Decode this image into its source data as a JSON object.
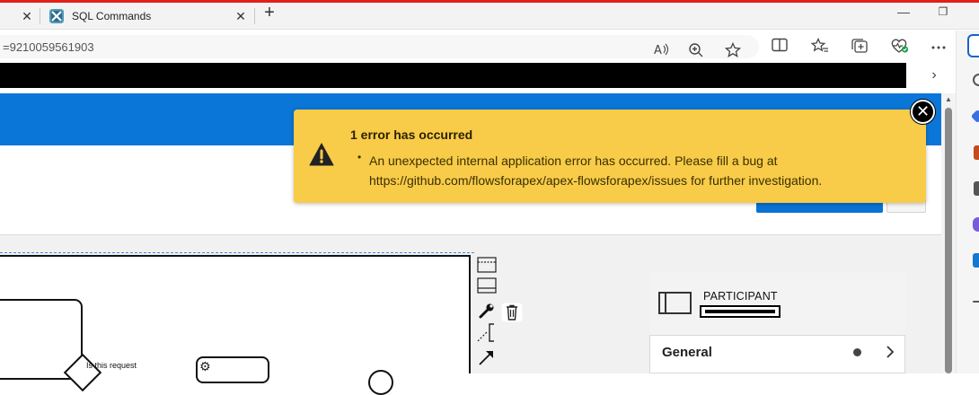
{
  "browser": {
    "tabs": [
      {
        "label": "",
        "close": "✕"
      },
      {
        "label": "SQL Commands",
        "close": "✕"
      }
    ],
    "new_tab": "+",
    "window_controls": {
      "minimize": "—",
      "maximize": "❐"
    },
    "url": "=9210059561903",
    "toolbar_icons": [
      "read-aloud-icon",
      "zoom-icon",
      "favorite-star-icon",
      "split-screen-icon",
      "favorites-icon",
      "collections-icon",
      "browser-essentials-icon",
      "more-icon"
    ],
    "bookmark_chevron": "›"
  },
  "error": {
    "title": "1 error has occurred",
    "bullet": "•",
    "message": "An unexpected internal application error has occurred. Please fill a bug at https://github.com/flowsforapex/apex-flowsforapex/issues for further investigation.",
    "close": "✕",
    "icon": "warning-icon"
  },
  "diagram": {
    "gateway_label": "Is this request"
  },
  "properties": {
    "element_type": "PARTICIPANT",
    "section": "General"
  },
  "colors": {
    "header_blue": "#0a76d8",
    "error_yellow": "#f8cb49",
    "accent_red": "#e0201b"
  }
}
